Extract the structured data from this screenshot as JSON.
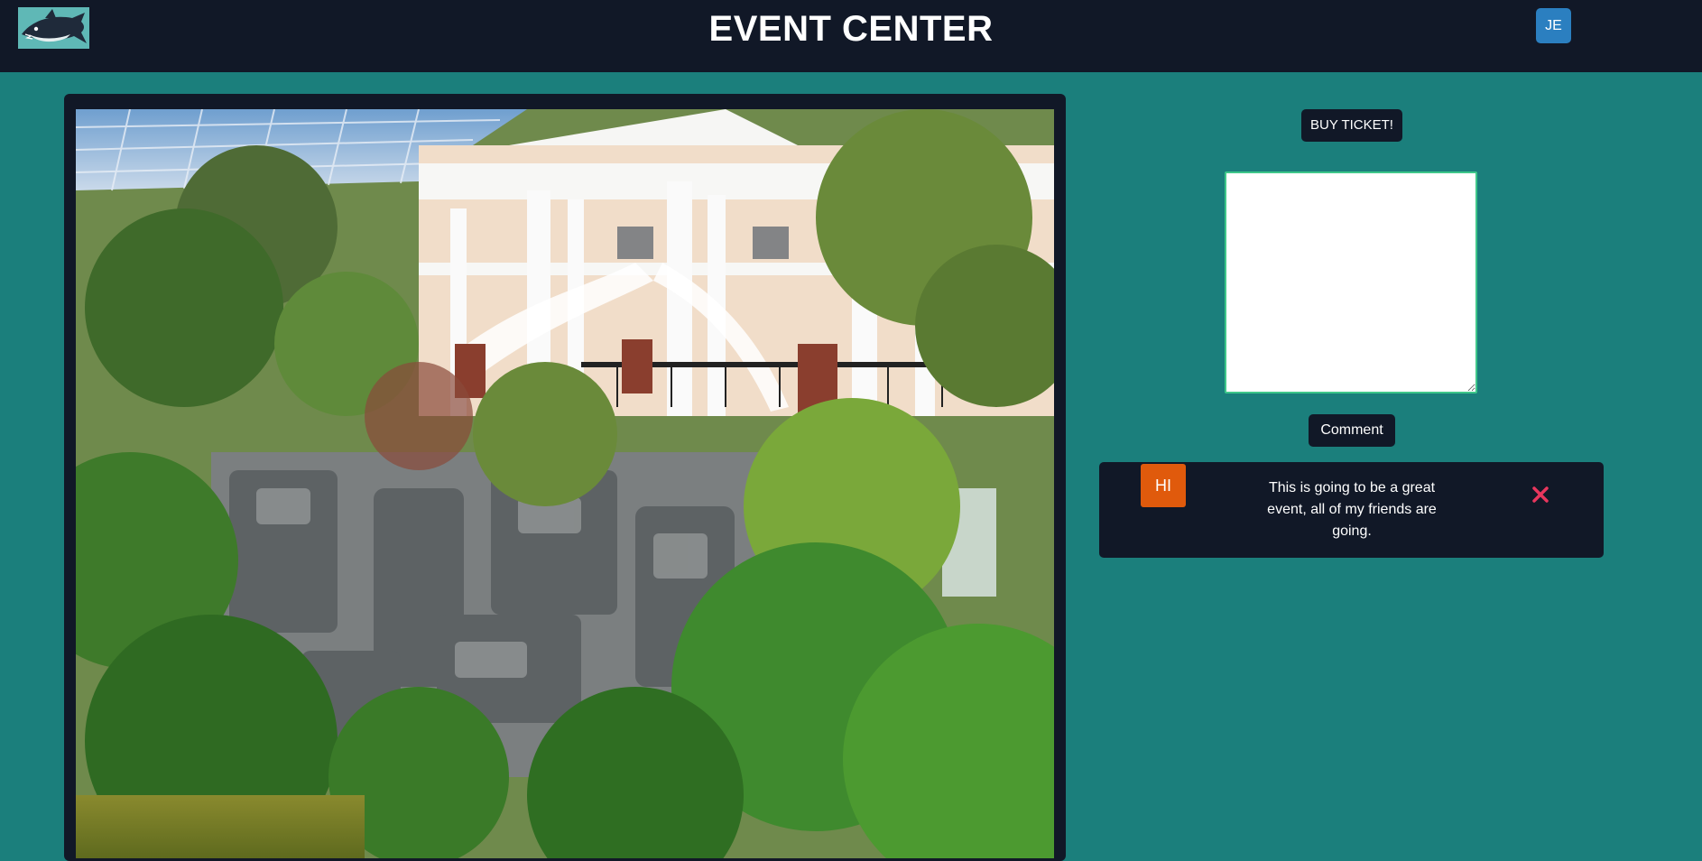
{
  "header": {
    "title": "EVENT CENTER",
    "logo_icon": "shark-logo-icon",
    "user_initials": "JE",
    "user_avatar_color": "#2b7fc0"
  },
  "event": {
    "image_icon": "event-photo",
    "buy_ticket_label": "BUY TICKET!"
  },
  "comment_form": {
    "input_value": "",
    "submit_label": "Comment"
  },
  "comments": [
    {
      "author_initials": "HI",
      "author_color": "#e05a0c",
      "text": "This is going to be a great event, all of my friends are going.",
      "delete_icon": "close-icon"
    }
  ],
  "theme": {
    "background": "#1b7f7c",
    "dark": "#111827",
    "accent_green": "#3ec78a",
    "delete_red": "#e8365d"
  }
}
